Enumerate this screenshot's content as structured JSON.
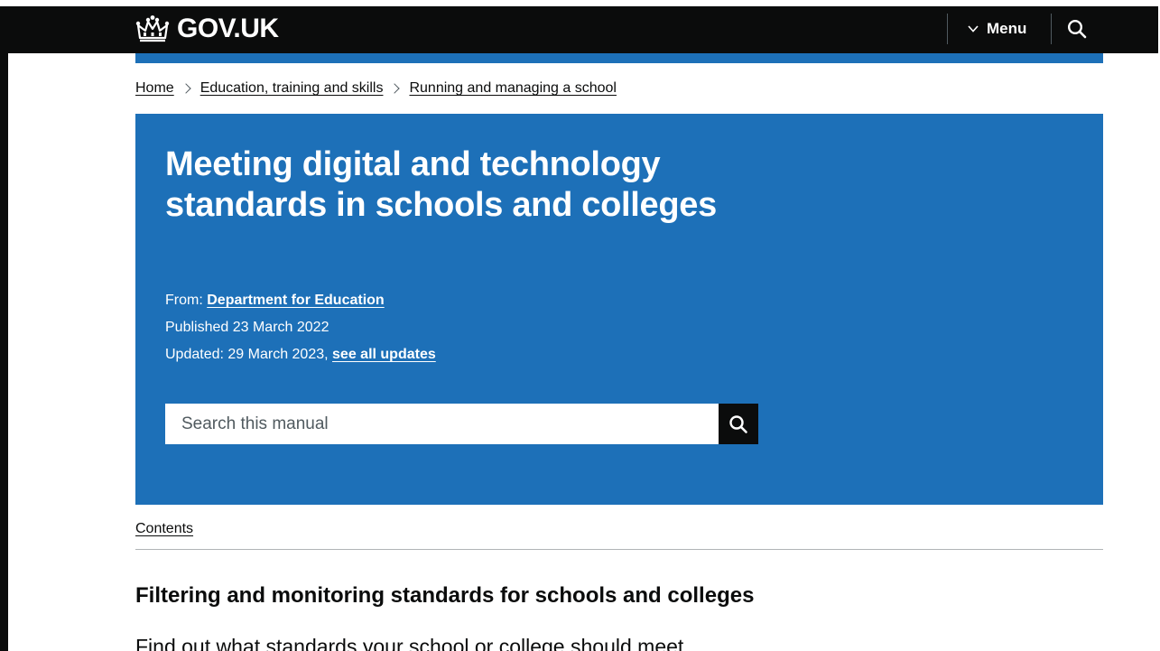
{
  "header": {
    "logo_text": "GOV.UK",
    "logo_icon": "crown-icon",
    "menu_label": "Menu",
    "menu_icon": "chevron-down-icon",
    "search_icon": "search-icon"
  },
  "breadcrumb": {
    "items": [
      {
        "label": "Home"
      },
      {
        "label": "Education, training and skills"
      },
      {
        "label": "Running and managing a school"
      }
    ]
  },
  "hero": {
    "title": "Meeting digital and technology standards in schools and colleges",
    "from_label": "From:",
    "from_org": "Department for Education",
    "published_label": "Published",
    "published_date": "23 March 2022",
    "updated_label": "Updated:",
    "updated_date": "29 March 2023,",
    "updates_link": "see all updates",
    "search_placeholder": "Search this manual",
    "search_icon": "search-icon"
  },
  "contents_label": "Contents",
  "section": {
    "title": "Filtering and monitoring standards for schools and colleges",
    "lede": "Find out what standards your school or college should meet"
  },
  "colors": {
    "brand_blue": "#1d70b8",
    "header_black": "#0b0c0c",
    "text": "#0b0c0c",
    "rule": "#b1b4b6"
  }
}
